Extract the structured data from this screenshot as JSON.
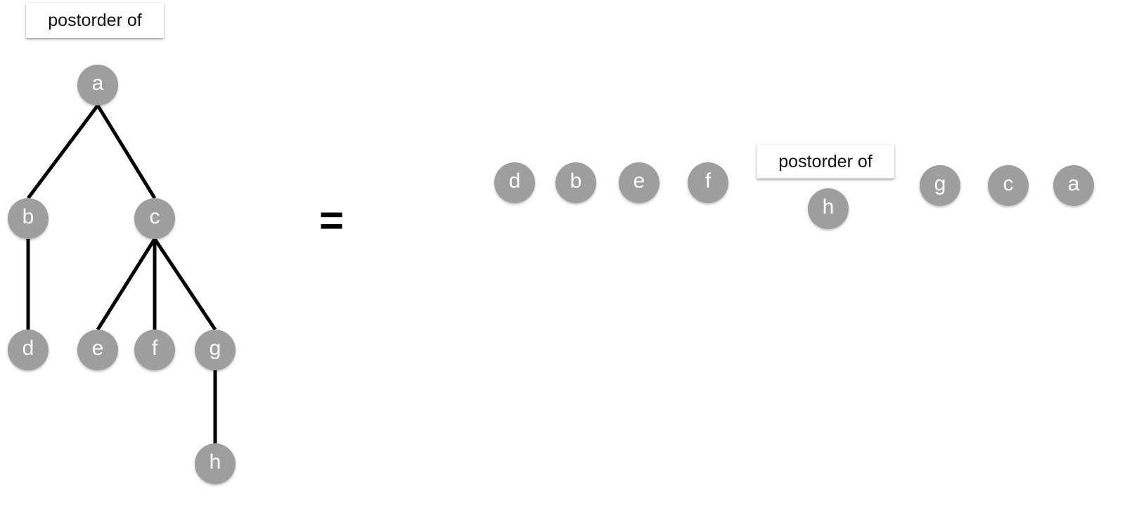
{
  "left_label": "postorder of",
  "right_label": "postorder of",
  "equals_sign": "=",
  "node_color": "#9e9e9e",
  "edge_color": "#000000",
  "tree": {
    "nodes": {
      "a": "a",
      "b": "b",
      "c": "c",
      "d": "d",
      "e": "e",
      "f": "f",
      "g": "g",
      "h": "h"
    },
    "edges": [
      [
        "a",
        "b"
      ],
      [
        "a",
        "c"
      ],
      [
        "b",
        "d"
      ],
      [
        "c",
        "e"
      ],
      [
        "c",
        "f"
      ],
      [
        "c",
        "g"
      ],
      [
        "g",
        "h"
      ]
    ]
  },
  "sequence": {
    "before": [
      "d",
      "b",
      "e",
      "f"
    ],
    "subtree": "h",
    "after": [
      "g",
      "c",
      "a"
    ]
  }
}
